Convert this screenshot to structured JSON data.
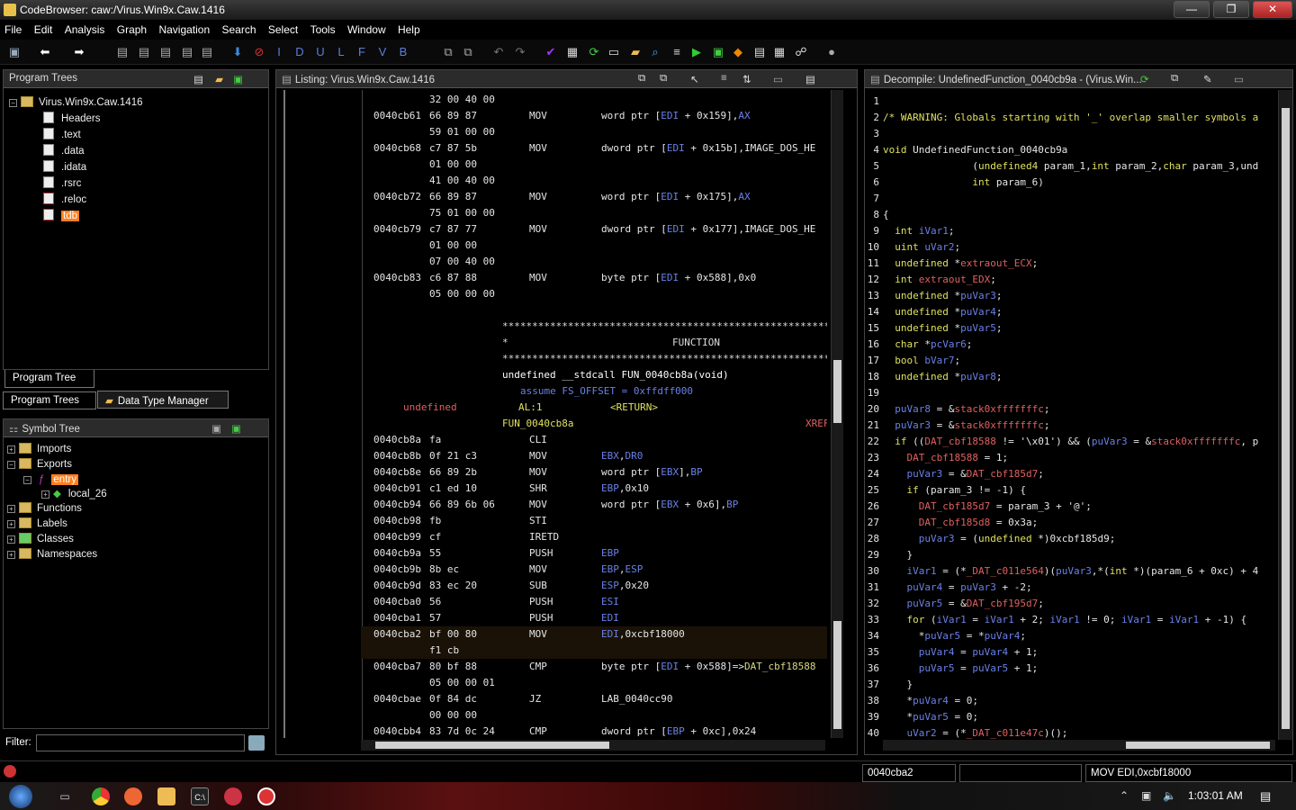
{
  "window": {
    "title": "CodeBrowser: caw:/Virus.Win9x.Caw.1416",
    "min": "—",
    "max": "❐",
    "close": "✕"
  },
  "menu": [
    "File",
    "Edit",
    "Analysis",
    "Graph",
    "Navigation",
    "Search",
    "Select",
    "Tools",
    "Window",
    "Help"
  ],
  "toolbar": {
    "letters": [
      "I",
      "D",
      "U",
      "L",
      "F",
      "V",
      "B"
    ]
  },
  "program_trees": {
    "title": "Program Trees",
    "root": "Virus.Win9x.Caw.1416",
    "items": [
      "Headers",
      ".text",
      ".data",
      ".idata",
      ".rsrc",
      ".reloc",
      "tdb"
    ],
    "tab_tree": "Program Tree",
    "tab_trees": "Program Trees",
    "tab_dtm": "Data Type Manager"
  },
  "symbol_tree": {
    "title": "Symbol Tree",
    "imports": "Imports",
    "exports": "Exports",
    "entry": "entry",
    "local": "local_26",
    "functions": "Functions",
    "labels": "Labels",
    "classes": "Classes",
    "namespaces": "Namespaces"
  },
  "filter": {
    "label": "Filter:"
  },
  "listing": {
    "title": "Listing:  Virus.Win9x.Caw.1416",
    "rows": [
      {
        "a": "",
        "b": "32 00 40 00",
        "m": "",
        "o": ""
      },
      {
        "a": "0040cb61",
        "b": "66 89 87",
        "m": "MOV",
        "o": "word ptr [EDI + 0x159],AX"
      },
      {
        "a": "",
        "b": "59 01 00 00",
        "m": "",
        "o": ""
      },
      {
        "a": "0040cb68",
        "b": "c7 87 5b",
        "m": "MOV",
        "o": "dword ptr [EDI + 0x15b],IMAGE_DOS_HE"
      },
      {
        "a": "",
        "b": "01 00 00",
        "m": "",
        "o": ""
      },
      {
        "a": "",
        "b": "41 00 40 00",
        "m": "",
        "o": ""
      },
      {
        "a": "0040cb72",
        "b": "66 89 87",
        "m": "MOV",
        "o": "word ptr [EDI + 0x175],AX"
      },
      {
        "a": "",
        "b": "75 01 00 00",
        "m": "",
        "o": ""
      },
      {
        "a": "0040cb79",
        "b": "c7 87 77",
        "m": "MOV",
        "o": "dword ptr [EDI + 0x177],IMAGE_DOS_HE"
      },
      {
        "a": "",
        "b": "01 00 00",
        "m": "",
        "o": ""
      },
      {
        "a": "",
        "b": "07 00 40 00",
        "m": "",
        "o": ""
      },
      {
        "a": "0040cb83",
        "b": "c6 87 88",
        "m": "MOV",
        "o": "byte ptr [EDI + 0x588],0x0"
      },
      {
        "a": "",
        "b": "05 00 00 00",
        "m": "",
        "o": ""
      }
    ],
    "stars": "**************************************************************",
    "star_single": "*",
    "function_word": "FUNCTION",
    "signature": "undefined __stdcall FUN_0040cb8a(void)",
    "assume": "assume FS_OFFSET = 0xffdff000",
    "ret_type": "undefined",
    "ret_reg": "AL:1",
    "ret_label": "<RETURN>",
    "func_label": "FUN_0040cb8a",
    "xref": "XREF",
    "rows2": [
      {
        "a": "0040cb8a",
        "b": "fa",
        "m": "CLI",
        "o": ""
      },
      {
        "a": "0040cb8b",
        "b": "0f 21 c3",
        "m": "MOV",
        "o": "EBX,DR0"
      },
      {
        "a": "0040cb8e",
        "b": "66 89 2b",
        "m": "MOV",
        "o": "word ptr [EBX],BP"
      },
      {
        "a": "0040cb91",
        "b": "c1 ed 10",
        "m": "SHR",
        "o": "EBP,0x10"
      },
      {
        "a": "0040cb94",
        "b": "66 89 6b 06",
        "m": "MOV",
        "o": "word ptr [EBX + 0x6],BP"
      },
      {
        "a": "0040cb98",
        "b": "fb",
        "m": "STI",
        "o": ""
      },
      {
        "a": "0040cb99",
        "b": "cf",
        "m": "IRETD",
        "o": ""
      },
      {
        "a": "0040cb9a",
        "b": "55",
        "m": "PUSH",
        "o": "EBP"
      },
      {
        "a": "0040cb9b",
        "b": "8b ec",
        "m": "MOV",
        "o": "EBP,ESP"
      },
      {
        "a": "0040cb9d",
        "b": "83 ec 20",
        "m": "SUB",
        "o": "ESP,0x20"
      },
      {
        "a": "0040cba0",
        "b": "56",
        "m": "PUSH",
        "o": "ESI"
      },
      {
        "a": "0040cba1",
        "b": "57",
        "m": "PUSH",
        "o": "EDI"
      },
      {
        "a": "0040cba2",
        "b": "bf 00 80",
        "m": "MOV",
        "o": "EDI,0xcbf18000"
      },
      {
        "a": "",
        "b": "f1 cb",
        "m": "",
        "o": ""
      },
      {
        "a": "0040cba7",
        "b": "80 bf 88",
        "m": "CMP",
        "o": "byte ptr [EDI + 0x588]=>DAT_cbf18588"
      },
      {
        "a": "",
        "b": "05 00 00 01",
        "m": "",
        "o": ""
      },
      {
        "a": "0040cbae",
        "b": "0f 84 dc",
        "m": "JZ",
        "o": "LAB_0040cc90"
      },
      {
        "a": "",
        "b": "00 00 00",
        "m": "",
        "o": ""
      },
      {
        "a": "0040cbb4",
        "b": "83 7d 0c 24",
        "m": "CMP",
        "o": "dword ptr [EBP + 0xc],0x24"
      }
    ]
  },
  "decompile": {
    "title": "Decompile: UndefinedFunction_0040cb9a -  (Virus.Win...",
    "lines": [
      "",
      "/* WARNING: Globals starting with '_' overlap smaller symbols a",
      "",
      "void UndefinedFunction_0040cb9a",
      "               (undefined4 param_1,int param_2,char param_3,und",
      "               int param_6)",
      "",
      "{",
      "  int iVar1;",
      "  uint uVar2;",
      "  undefined *extraout_ECX;",
      "  int extraout_EDX;",
      "  undefined *puVar3;",
      "  undefined *puVar4;",
      "  undefined *puVar5;",
      "  char *pcVar6;",
      "  bool bVar7;",
      "  undefined *puVar8;",
      "",
      "  puVar8 = &stack0xfffffffc;",
      "  puVar3 = &stack0xfffffffc;",
      "  if ((DAT_cbf18588 != '\\x01') && (puVar3 = &stack0xfffffffc, p",
      "    DAT_cbf18588 = 1;",
      "    puVar3 = &DAT_cbf185d7;",
      "    if (param_3 != -1) {",
      "      DAT_cbf185d7 = param_3 + '@';",
      "      DAT_cbf185d8 = 0x3a;",
      "      puVar3 = (undefined *)0xcbf185d9;",
      "    }",
      "    iVar1 = (*_DAT_c011e564)(puVar3,*(int *)(param_6 + 0xc) + 4",
      "    puVar4 = puVar3 + -2;",
      "    puVar5 = &DAT_cbf195d7;",
      "    for (iVar1 = iVar1 + 2; iVar1 != 0; iVar1 = iVar1 + -1) {",
      "      *puVar5 = *puVar4;",
      "      puVar4 = puVar4 + 1;",
      "      puVar5 = puVar5 + 1;",
      "    }",
      "    *puVar4 = 0;",
      "    *puVar5 = 0;",
      "    uVar2 = (*_DAT_c011e47c)();"
    ]
  },
  "status": {
    "address": "0040cba2",
    "instruction": "MOV EDI,0xcbf18000"
  },
  "taskbar": {
    "time": "1:03:01 AM"
  }
}
